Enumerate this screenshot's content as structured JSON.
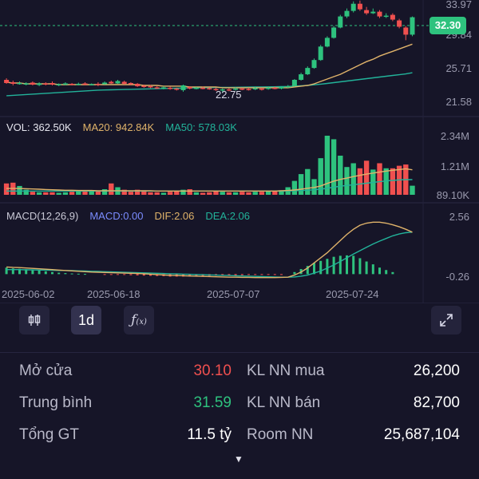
{
  "chart_data": [
    {
      "type": "candlestick",
      "title": "",
      "ylim": [
        21.58,
        33.97
      ],
      "y_ticks": [
        "33.97",
        "29.84",
        "25.71",
        "21.58"
      ],
      "last_price": "32.30",
      "min_marker": "22.75",
      "x_ticks": [
        "2025-06-02",
        "2025-06-18",
        "2025-07-07",
        "2025-07-24"
      ],
      "candles": [
        {
          "o": 24.4,
          "c": 24.0,
          "h": 24.6,
          "l": 23.9
        },
        {
          "o": 24.1,
          "c": 23.9,
          "h": 24.3,
          "l": 23.7
        },
        {
          "o": 23.9,
          "c": 24.0,
          "h": 24.2,
          "l": 23.8
        },
        {
          "o": 23.8,
          "c": 23.95,
          "h": 24.1,
          "l": 23.7
        },
        {
          "o": 24.05,
          "c": 23.8,
          "h": 24.2,
          "l": 23.7
        },
        {
          "o": 23.75,
          "c": 23.95,
          "h": 24.1,
          "l": 23.6
        },
        {
          "o": 23.95,
          "c": 23.85,
          "h": 24.1,
          "l": 23.7
        },
        {
          "o": 24.0,
          "c": 23.8,
          "h": 24.2,
          "l": 23.7
        },
        {
          "o": 23.7,
          "c": 23.85,
          "h": 23.95,
          "l": 23.6
        },
        {
          "o": 23.8,
          "c": 23.95,
          "h": 24.1,
          "l": 23.7
        },
        {
          "o": 23.9,
          "c": 23.8,
          "h": 24.0,
          "l": 23.7
        },
        {
          "o": 23.8,
          "c": 23.9,
          "h": 24.05,
          "l": 23.7
        },
        {
          "o": 23.95,
          "c": 23.8,
          "h": 24.1,
          "l": 23.7
        },
        {
          "o": 23.8,
          "c": 23.85,
          "h": 23.95,
          "l": 23.7
        },
        {
          "o": 23.9,
          "c": 23.75,
          "h": 24.1,
          "l": 23.6
        },
        {
          "o": 23.85,
          "c": 24.05,
          "h": 24.2,
          "l": 23.8
        },
        {
          "o": 24.15,
          "c": 23.95,
          "h": 24.3,
          "l": 23.9
        },
        {
          "o": 23.95,
          "c": 24.25,
          "h": 24.4,
          "l": 23.9
        },
        {
          "o": 24.15,
          "c": 23.9,
          "h": 24.3,
          "l": 23.8
        },
        {
          "o": 24.0,
          "c": 23.85,
          "h": 24.1,
          "l": 23.7
        },
        {
          "o": 23.9,
          "c": 23.6,
          "h": 24.0,
          "l": 23.5
        },
        {
          "o": 23.65,
          "c": 23.55,
          "h": 23.8,
          "l": 23.4
        },
        {
          "o": 23.6,
          "c": 23.45,
          "h": 23.75,
          "l": 23.35
        },
        {
          "o": 23.45,
          "c": 23.35,
          "h": 23.6,
          "l": 23.25
        },
        {
          "o": 23.3,
          "c": 23.45,
          "h": 23.6,
          "l": 23.2
        },
        {
          "o": 23.4,
          "c": 23.3,
          "h": 23.55,
          "l": 23.15
        },
        {
          "o": 23.3,
          "c": 23.2,
          "h": 23.4,
          "l": 23.05
        },
        {
          "o": 23.1,
          "c": 23.7,
          "h": 23.8,
          "l": 22.9
        },
        {
          "o": 23.5,
          "c": 23.3,
          "h": 23.6,
          "l": 23.2
        },
        {
          "o": 23.3,
          "c": 23.4,
          "h": 23.5,
          "l": 23.2
        },
        {
          "o": 23.4,
          "c": 23.3,
          "h": 23.55,
          "l": 23.2
        },
        {
          "o": 23.35,
          "c": 23.25,
          "h": 23.45,
          "l": 23.15
        },
        {
          "o": 23.25,
          "c": 23.15,
          "h": 23.4,
          "l": 23.0
        },
        {
          "o": 23.15,
          "c": 23.2,
          "h": 23.3,
          "l": 22.75
        },
        {
          "o": 23.2,
          "c": 23.1,
          "h": 23.35,
          "l": 22.95
        },
        {
          "o": 23.15,
          "c": 23.3,
          "h": 23.45,
          "l": 23.05
        },
        {
          "o": 23.3,
          "c": 23.25,
          "h": 23.4,
          "l": 23.1
        },
        {
          "o": 23.25,
          "c": 23.15,
          "h": 23.4,
          "l": 23.05
        },
        {
          "o": 23.2,
          "c": 23.35,
          "h": 23.5,
          "l": 23.1
        },
        {
          "o": 23.3,
          "c": 23.2,
          "h": 23.4,
          "l": 23.05
        },
        {
          "o": 23.25,
          "c": 23.4,
          "h": 23.55,
          "l": 23.15
        },
        {
          "o": 23.4,
          "c": 23.3,
          "h": 23.55,
          "l": 23.2
        },
        {
          "o": 23.3,
          "c": 23.5,
          "h": 23.6,
          "l": 23.2
        },
        {
          "o": 23.5,
          "c": 23.6,
          "h": 23.75,
          "l": 23.4
        },
        {
          "o": 23.6,
          "c": 24.4,
          "h": 24.5,
          "l": 23.55
        },
        {
          "o": 24.4,
          "c": 25.1,
          "h": 25.3,
          "l": 24.3
        },
        {
          "o": 25.1,
          "c": 25.9,
          "h": 26.1,
          "l": 25.0
        },
        {
          "o": 25.9,
          "c": 26.9,
          "h": 27.1,
          "l": 25.8
        },
        {
          "o": 26.9,
          "c": 28.6,
          "h": 28.8,
          "l": 26.8
        },
        {
          "o": 28.6,
          "c": 29.7,
          "h": 29.9,
          "l": 28.5
        },
        {
          "o": 29.7,
          "c": 31.0,
          "h": 31.2,
          "l": 29.6
        },
        {
          "o": 31.0,
          "c": 32.4,
          "h": 32.6,
          "l": 30.9
        },
        {
          "o": 32.4,
          "c": 33.1,
          "h": 33.4,
          "l": 32.2
        },
        {
          "o": 33.1,
          "c": 34.0,
          "h": 34.3,
          "l": 32.9
        },
        {
          "o": 34.0,
          "c": 33.3,
          "h": 34.4,
          "l": 33.1
        },
        {
          "o": 33.2,
          "c": 32.8,
          "h": 33.6,
          "l": 32.6
        },
        {
          "o": 32.8,
          "c": 33.0,
          "h": 33.4,
          "l": 32.7
        },
        {
          "o": 33.0,
          "c": 32.4,
          "h": 33.2,
          "l": 32.2
        },
        {
          "o": 32.4,
          "c": 32.5,
          "h": 32.8,
          "l": 32.2
        },
        {
          "o": 32.6,
          "c": 32.0,
          "h": 32.8,
          "l": 31.8
        },
        {
          "o": 31.9,
          "c": 31.1,
          "h": 32.1,
          "l": 30.9
        },
        {
          "o": 31.0,
          "c": 30.1,
          "h": 31.2,
          "l": 29.4
        },
        {
          "o": 30.1,
          "c": 32.3,
          "h": 32.4,
          "l": 29.9
        }
      ],
      "ma_fast": [
        24.1,
        24.0,
        24.0,
        23.9,
        23.9,
        23.9,
        23.9,
        23.9,
        23.8,
        23.8,
        23.8,
        23.8,
        23.8,
        23.8,
        23.8,
        23.8,
        23.8,
        23.8,
        23.8,
        23.8,
        23.8,
        23.7,
        23.7,
        23.7,
        23.6,
        23.6,
        23.6,
        23.6,
        23.5,
        23.5,
        23.5,
        23.5,
        23.5,
        23.4,
        23.4,
        23.4,
        23.4,
        23.4,
        23.4,
        23.4,
        23.4,
        23.4,
        23.4,
        23.4,
        23.5,
        23.6,
        23.7,
        23.9,
        24.2,
        24.5,
        24.8,
        25.1,
        25.5,
        25.9,
        26.3,
        26.7,
        27.0,
        27.4,
        27.7,
        28.0,
        28.3,
        28.6,
        28.9
      ],
      "ma_slow": [
        22.4,
        22.45,
        22.5,
        22.55,
        22.6,
        22.65,
        22.7,
        22.75,
        22.8,
        22.85,
        22.9,
        22.95,
        23.0,
        23.05,
        23.1,
        23.12,
        23.14,
        23.16,
        23.18,
        23.2,
        23.22,
        23.24,
        23.26,
        23.28,
        23.3,
        23.32,
        23.34,
        23.36,
        23.38,
        23.4,
        23.41,
        23.42,
        23.43,
        23.44,
        23.45,
        23.46,
        23.47,
        23.48,
        23.49,
        23.5,
        23.51,
        23.52,
        23.54,
        23.56,
        23.6,
        23.65,
        23.7,
        23.78,
        23.86,
        23.95,
        24.05,
        24.15,
        24.25,
        24.35,
        24.45,
        24.55,
        24.65,
        24.75,
        24.85,
        24.95,
        25.05,
        25.15,
        25.3
      ]
    },
    {
      "type": "bar",
      "title": "",
      "ylim": [
        0,
        2.34
      ],
      "y_ticks": [
        "2.34M",
        "1.21M",
        "89.10K"
      ],
      "values_millions": [
        0.45,
        0.48,
        0.35,
        0.2,
        0.12,
        0.1,
        0.1,
        0.1,
        0.08,
        0.1,
        0.12,
        0.15,
        0.16,
        0.18,
        0.15,
        0.22,
        0.45,
        0.3,
        0.2,
        0.12,
        0.2,
        0.18,
        0.1,
        0.1,
        0.08,
        0.12,
        0.15,
        0.2,
        0.22,
        0.1,
        0.08,
        0.1,
        0.15,
        0.12,
        0.1,
        0.1,
        0.12,
        0.1,
        0.12,
        0.12,
        0.14,
        0.15,
        0.18,
        0.3,
        0.55,
        0.82,
        1.02,
        0.62,
        1.45,
        2.34,
        2.2,
        1.55,
        1.1,
        1.25,
        1.05,
        1.35,
        1.0,
        1.25,
        1.05,
        1.05,
        1.15,
        1.2,
        0.36
      ],
      "ma20_line": [
        0.25,
        0.25,
        0.25,
        0.24,
        0.23,
        0.22,
        0.21,
        0.2,
        0.19,
        0.18,
        0.18,
        0.17,
        0.17,
        0.17,
        0.16,
        0.16,
        0.16,
        0.16,
        0.16,
        0.16,
        0.16,
        0.16,
        0.16,
        0.15,
        0.15,
        0.15,
        0.15,
        0.15,
        0.15,
        0.15,
        0.15,
        0.15,
        0.15,
        0.15,
        0.15,
        0.15,
        0.15,
        0.15,
        0.15,
        0.15,
        0.15,
        0.15,
        0.16,
        0.17,
        0.19,
        0.22,
        0.26,
        0.29,
        0.35,
        0.45,
        0.54,
        0.61,
        0.66,
        0.72,
        0.77,
        0.82,
        0.86,
        0.9,
        0.94,
        0.97,
        1.0,
        1.03,
        0.99
      ],
      "ma50_line": [
        0.15,
        0.15,
        0.15,
        0.15,
        0.15,
        0.15,
        0.15,
        0.15,
        0.15,
        0.15,
        0.15,
        0.15,
        0.15,
        0.15,
        0.15,
        0.15,
        0.15,
        0.15,
        0.15,
        0.15,
        0.15,
        0.15,
        0.15,
        0.15,
        0.15,
        0.15,
        0.15,
        0.15,
        0.15,
        0.15,
        0.15,
        0.15,
        0.15,
        0.15,
        0.15,
        0.15,
        0.15,
        0.15,
        0.15,
        0.15,
        0.15,
        0.15,
        0.15,
        0.15,
        0.16,
        0.17,
        0.18,
        0.2,
        0.22,
        0.26,
        0.3,
        0.34,
        0.37,
        0.4,
        0.43,
        0.46,
        0.49,
        0.52,
        0.55,
        0.57,
        0.59,
        0.6,
        0.6
      ],
      "legend": {
        "vol": "VOL: 362.50K",
        "ma20": "MA20: 942.84K",
        "ma50": "MA50: 578.03K"
      }
    },
    {
      "type": "line",
      "title": "",
      "ylim": [
        -0.26,
        2.56
      ],
      "y_ticks": [
        "2.56",
        "-0.26"
      ],
      "legend": {
        "name": "MACD(12,26,9)",
        "macd": "MACD:0.00",
        "dif": "DIF:2.06",
        "dea": "DEA:2.06"
      },
      "dif": [
        0.35,
        0.33,
        0.32,
        0.3,
        0.28,
        0.26,
        0.24,
        0.22,
        0.2,
        0.18,
        0.16,
        0.14,
        0.12,
        0.1,
        0.09,
        0.08,
        0.07,
        0.06,
        0.05,
        0.04,
        0.03,
        0.02,
        0.0,
        -0.02,
        -0.04,
        -0.06,
        -0.07,
        -0.08,
        -0.09,
        -0.1,
        -0.11,
        -0.12,
        -0.13,
        -0.14,
        -0.15,
        -0.15,
        -0.16,
        -0.16,
        -0.17,
        -0.17,
        -0.17,
        -0.17,
        -0.16,
        -0.15,
        -0.05,
        0.1,
        0.3,
        0.55,
        0.8,
        1.05,
        1.35,
        1.65,
        1.95,
        2.2,
        2.4,
        2.5,
        2.55,
        2.55,
        2.5,
        2.42,
        2.32,
        2.2,
        2.06
      ],
      "dea": [
        0.22,
        0.22,
        0.22,
        0.21,
        0.21,
        0.2,
        0.2,
        0.19,
        0.18,
        0.18,
        0.17,
        0.16,
        0.15,
        0.14,
        0.13,
        0.12,
        0.11,
        0.1,
        0.09,
        0.08,
        0.07,
        0.06,
        0.05,
        0.04,
        0.03,
        0.02,
        0.01,
        0.0,
        -0.01,
        -0.02,
        -0.03,
        -0.04,
        -0.05,
        -0.06,
        -0.07,
        -0.08,
        -0.09,
        -0.1,
        -0.11,
        -0.12,
        -0.13,
        -0.14,
        -0.15,
        -0.15,
        -0.14,
        -0.1,
        -0.05,
        0.05,
        0.15,
        0.3,
        0.45,
        0.62,
        0.8,
        0.98,
        1.15,
        1.32,
        1.48,
        1.62,
        1.75,
        1.88,
        1.97,
        2.03,
        2.06
      ],
      "macd_bars": [
        0.32,
        0.28,
        0.26,
        0.24,
        0.22,
        0.18,
        0.14,
        0.1,
        0.07,
        0.05,
        0.03,
        0.02,
        0.01,
        0.0,
        0.0,
        -0.01,
        -0.02,
        -0.03,
        -0.04,
        -0.05,
        -0.06,
        -0.07,
        -0.08,
        -0.09,
        -0.1,
        -0.12,
        -0.12,
        -0.12,
        -0.12,
        -0.11,
        -0.1,
        -0.09,
        -0.08,
        -0.07,
        -0.06,
        -0.06,
        -0.05,
        -0.04,
        -0.03,
        -0.03,
        -0.02,
        -0.02,
        -0.01,
        0.0,
        0.1,
        0.25,
        0.4,
        0.55,
        0.65,
        0.75,
        0.85,
        0.9,
        0.92,
        0.9,
        0.78,
        0.62,
        0.48,
        0.32,
        0.2,
        0.1,
        0.0,
        0.0,
        0.0
      ]
    }
  ],
  "toolbar": {
    "candle_icon": "candlestick-icon",
    "period_label": "1d",
    "indicator_icon": "function-icon",
    "expand_icon": "expand-icon"
  },
  "stats": {
    "rows": [
      {
        "left_label": "Mở cửa",
        "left_value": "30.10",
        "right_label": "KL NN mua",
        "right_value": "26,200"
      },
      {
        "left_label": "Trung bình",
        "left_value": "31.59",
        "right_label": "KL NN bán",
        "right_value": "82,700"
      },
      {
        "left_label": "Tổng GT",
        "left_value": "11.5 tỷ",
        "right_label": "Room NN",
        "right_value": "25,687,104"
      }
    ]
  },
  "more_icon": "chevron-down-icon",
  "colors": {
    "up": "#2ec27e",
    "down": "#f0504f",
    "ma_fast": "#e0b36a",
    "ma_slow": "#22b39a",
    "macd_label": "#7b8cff"
  }
}
